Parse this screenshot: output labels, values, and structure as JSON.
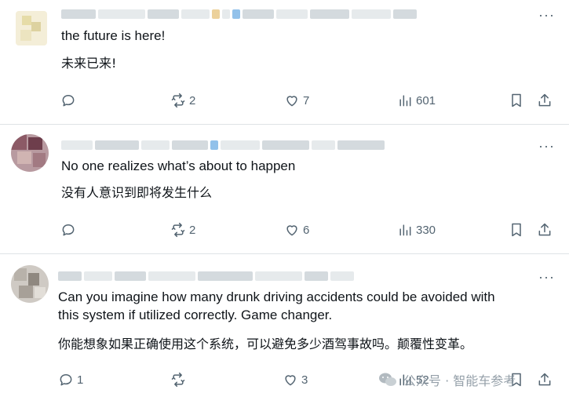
{
  "posts": [
    {
      "text_en": "the future is here!",
      "text_cn": "未来已来!",
      "replies": "",
      "reposts": "2",
      "likes": "7",
      "views": "601"
    },
    {
      "text_en": "No one realizes what’s about to happen",
      "text_cn": "没有人意识到即将发生什么",
      "replies": "",
      "reposts": "2",
      "likes": "6",
      "views": "330"
    },
    {
      "text_en_line1": "Can you imagine how many drunk driving accidents could be avoided with",
      "text_en_line2": "this system if utilized correctly. Game changer.",
      "text_cn": "你能想象如果正确使用这个系统，可以避免多少酒驾事故吗。颠覆性变革。",
      "replies": "1",
      "reposts": "",
      "likes": "3",
      "views": "52"
    }
  ],
  "more_glyph": "···",
  "watermark": {
    "text": "公众号 · 智能车参考"
  },
  "icons": {
    "reply": "reply-bubble-icon",
    "repost": "repost-arrows-icon",
    "like": "heart-icon",
    "views": "bar-chart-icon",
    "bookmark": "bookmark-icon",
    "share": "share-upload-icon"
  },
  "colors": {
    "icon_gray": "#536471",
    "text": "#0f1419",
    "divider": "#dfe3e6"
  }
}
